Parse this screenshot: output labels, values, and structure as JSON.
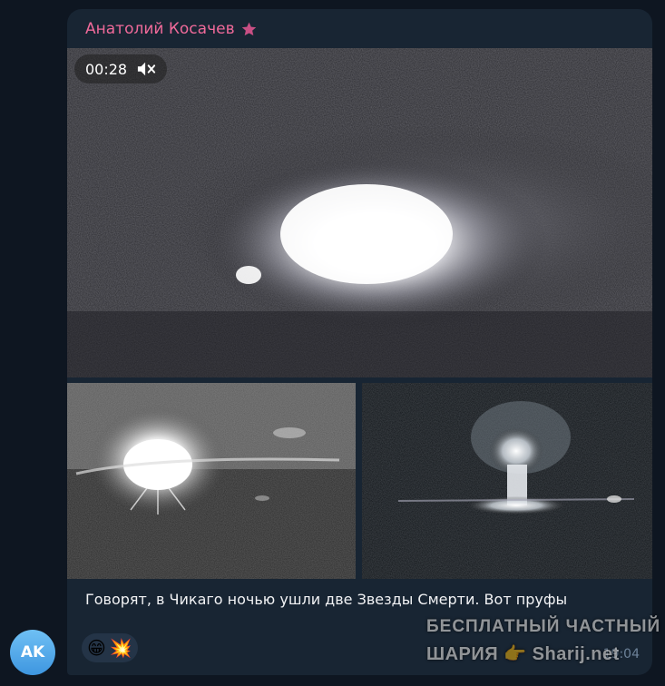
{
  "message": {
    "sender": "Анатолий Косачев",
    "avatar_initials": "AK",
    "video_duration": "00:28",
    "caption": "Говорят, в Чикаго ночью ушли две Звезды Смерти. Вот пруфы",
    "reactions": [
      "😁",
      "💥"
    ],
    "time": "19:04"
  },
  "watermark": {
    "line1": "БЕСПЛАТНЫЙ ЧАСТНЫЙ",
    "line2": "ШАРИЯ 👉 Sharij.net"
  },
  "icons": {
    "premium": "star-icon",
    "mute": "speaker-muted-icon"
  },
  "colors": {
    "background": "#0e1621",
    "bubble": "#182533",
    "sender": "#f06a9a",
    "avatar": "#4aa3e8"
  }
}
